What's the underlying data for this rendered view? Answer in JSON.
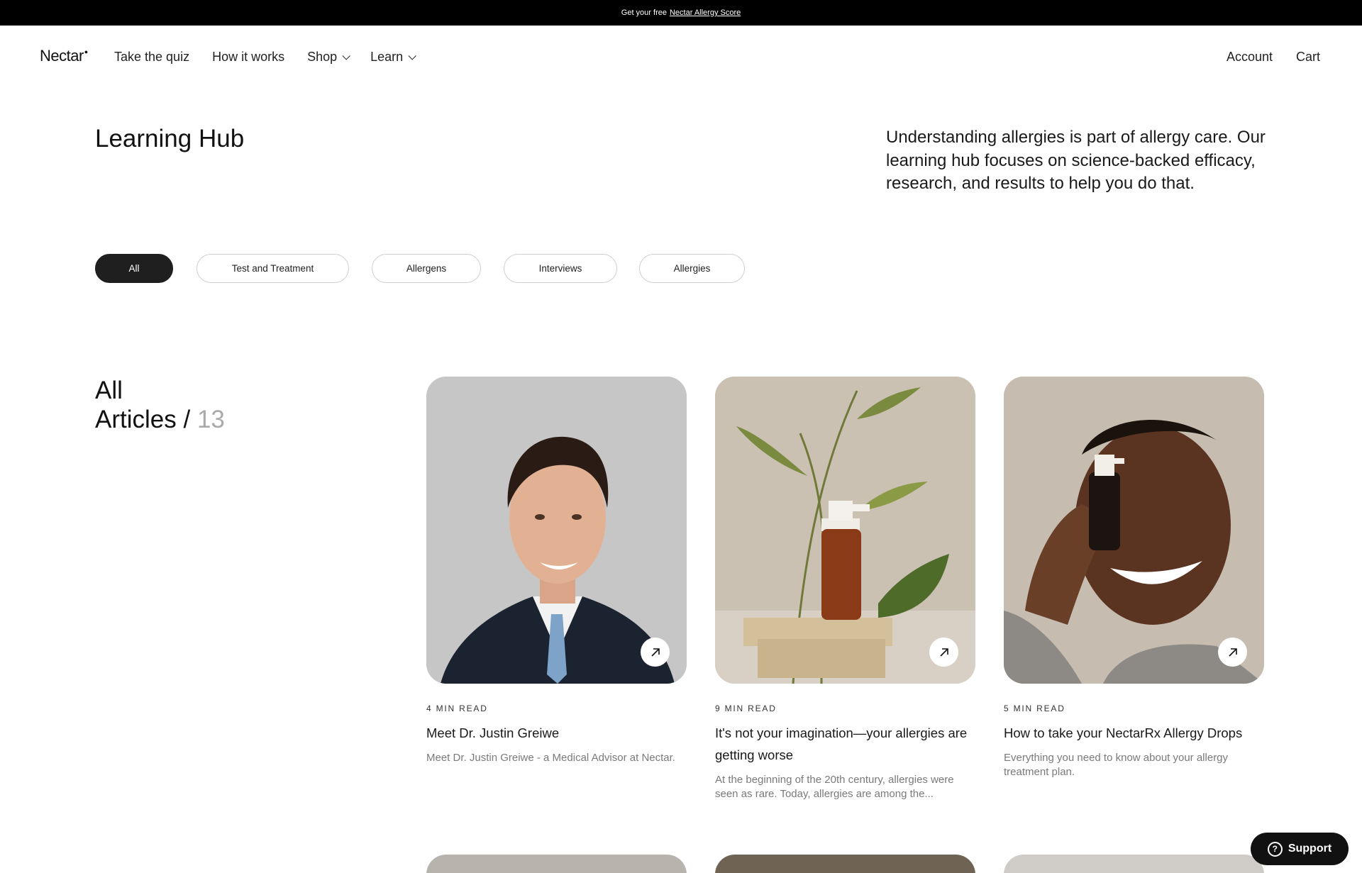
{
  "announcement": {
    "prefix": "Get your free",
    "link": "Nectar Allergy Score"
  },
  "header": {
    "logo": "Nectar",
    "nav": [
      {
        "label": "Take the quiz"
      },
      {
        "label": "How it works"
      },
      {
        "label": "Shop",
        "dropdown": true
      },
      {
        "label": "Learn",
        "dropdown": true
      }
    ],
    "right": {
      "account": "Account",
      "cart": "Cart"
    }
  },
  "hero": {
    "title": "Learning Hub",
    "description": "Understanding allergies is part of allergy care. Our learning hub focuses on science-backed efficacy, research, and results to help you do that."
  },
  "filters": [
    {
      "label": "All",
      "active": true
    },
    {
      "label": "Test and Treatment",
      "active": false
    },
    {
      "label": "Allergens",
      "active": false
    },
    {
      "label": "Interviews",
      "active": false
    },
    {
      "label": "Allergies",
      "active": false
    }
  ],
  "articles": {
    "heading_line1": "All",
    "heading_line2": "Articles /",
    "count": "13",
    "items": [
      {
        "read_time": "4 MIN READ",
        "title": "Meet Dr. Justin Greiwe",
        "excerpt": "Meet Dr. Justin Greiwe - a Medical Advisor at Nectar."
      },
      {
        "read_time": "9 MIN READ",
        "title": "It's not your imagination—your allergies are getting worse",
        "excerpt": "At the beginning of the 20th century, allergies were seen as rare. Today, allergies are among the..."
      },
      {
        "read_time": "5 MIN READ",
        "title": "How to take your NectarRx Allergy Drops",
        "excerpt": "Everything you need to know about your allergy treatment plan."
      }
    ]
  },
  "product_label": "Nectar",
  "support": {
    "label": "Support"
  },
  "colors": {
    "dark": "#1f1f1f",
    "muted": "#7a7a7a",
    "count": "#aaaaaa"
  }
}
